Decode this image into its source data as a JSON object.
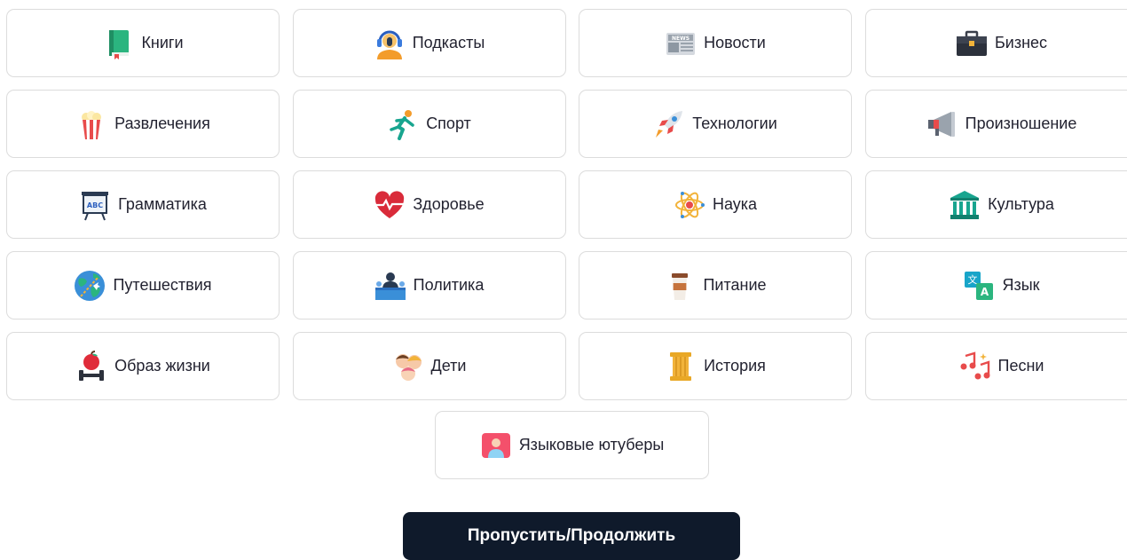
{
  "topics": [
    {
      "label": "Книги",
      "icon": "book-icon"
    },
    {
      "label": "Подкасты",
      "icon": "podcast-icon"
    },
    {
      "label": "Новости",
      "icon": "newspaper-icon"
    },
    {
      "label": "Бизнес",
      "icon": "briefcase-icon"
    },
    {
      "label": "Развлечения",
      "icon": "popcorn-icon"
    },
    {
      "label": "Спорт",
      "icon": "runner-icon"
    },
    {
      "label": "Технологии",
      "icon": "rocket-icon"
    },
    {
      "label": "Произношение",
      "icon": "megaphone-icon"
    },
    {
      "label": "Грамматика",
      "icon": "abc-board-icon"
    },
    {
      "label": "Здоровье",
      "icon": "heartbeat-icon"
    },
    {
      "label": "Наука",
      "icon": "atom-icon"
    },
    {
      "label": "Культура",
      "icon": "museum-icon"
    },
    {
      "label": "Путешествия",
      "icon": "globe-plane-icon"
    },
    {
      "label": "Политика",
      "icon": "politician-podium-icon"
    },
    {
      "label": "Питание",
      "icon": "coffee-cup-icon"
    },
    {
      "label": "Язык",
      "icon": "translate-icon"
    },
    {
      "label": "Образ жизни",
      "icon": "apple-dumbbell-icon"
    },
    {
      "label": "Дети",
      "icon": "children-icon"
    },
    {
      "label": "История",
      "icon": "column-icon"
    },
    {
      "label": "Песни",
      "icon": "music-notes-icon"
    }
  ],
  "extra_topic": {
    "label": "Языковые ютуберы",
    "icon": "youtuber-icon"
  },
  "continue_button": {
    "label": "Пропустить/Продолжить"
  },
  "colors": {
    "card_border": "#dcdcdc",
    "button_bg": "#0f1a2b",
    "button_text": "#ffffff"
  }
}
